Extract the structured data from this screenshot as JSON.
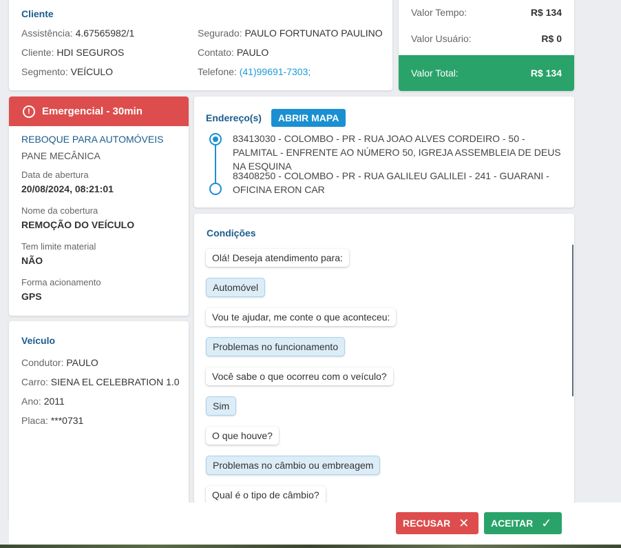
{
  "client": {
    "title": "Cliente",
    "assistencia_label": "Assistência:",
    "assistencia_value": "4.67565982/1",
    "cliente_label": "Cliente:",
    "cliente_value": "HDI SEGUROS",
    "segmento_label": "Segmento:",
    "segmento_value": "VEÍCULO",
    "segurado_label": "Segurado:",
    "segurado_value": "PAULO FORTUNATO PAULINO",
    "contato_label": "Contato:",
    "contato_value": "PAULO",
    "telefone_label": "Telefone:",
    "telefone_value": "(41)99691-7303;"
  },
  "values": {
    "tempo_label": "Valor Tempo:",
    "tempo_value": "R$ 134",
    "usuario_label": "Valor Usuário:",
    "usuario_value": "R$ 0",
    "total_label": "Valor Total:",
    "total_value": "R$ 134",
    "total_color": "#29a36a"
  },
  "emergency": {
    "banner_icon": "info-circle-icon",
    "banner_text": "Emergencial - 30min",
    "banner_color": "#de4d4d",
    "service_title": "REBOQUE PARA AUTOMÓVEIS",
    "service_sub": "PANE MECÂNICA",
    "fields": [
      {
        "label": "Data de abertura",
        "value": "20/08/2024, 08:21:01"
      },
      {
        "label": "Nome da cobertura",
        "value": "REMOÇÃO DO VEÍCULO"
      },
      {
        "label": "Tem limite material",
        "value": "NÃO"
      },
      {
        "label": "Forma acionamento",
        "value": "GPS"
      }
    ]
  },
  "vehicle": {
    "title": "Veículo",
    "condutor_label": "Condutor:",
    "condutor_value": "PAULO",
    "carro_label": "Carro:",
    "carro_value": "SIENA EL CELEBRATION 1.0",
    "ano_label": "Ano:",
    "ano_value": "2011",
    "placa_label": "Placa:",
    "placa_value": "***0731"
  },
  "address": {
    "title": "Endereço(s)",
    "map_button": "ABRIR MAPA",
    "origin": "83413030 - COLOMBO - PR - RUA JOAO ALVES CORDEIRO - 50 - PALMITAL - ENFRENTE AO NÚMERO 50, IGREJA ASSEMBLEIA DE DEUS NA ESQUINA",
    "destination": "83408250 - COLOMBO - PR - RUA GALILEU GALILEI - 241 - GUARANI - OFICINA ERON CAR"
  },
  "conditions": {
    "title": "Condições",
    "messages": [
      {
        "from": "sys",
        "text": "Olá! Deseja atendimento para:"
      },
      {
        "from": "usr",
        "text": "Automóvel"
      },
      {
        "from": "sys",
        "text": "Vou te ajudar, me conte o que aconteceu:"
      },
      {
        "from": "usr",
        "text": "Problemas no funcionamento"
      },
      {
        "from": "sys",
        "text": "Você sabe o que ocorreu com o veículo?"
      },
      {
        "from": "usr",
        "text": "Sim"
      },
      {
        "from": "sys",
        "text": "O que houve?"
      },
      {
        "from": "usr",
        "text": "Problemas no câmbio ou embreagem"
      },
      {
        "from": "sys",
        "text": "Qual é o tipo de câmbio?"
      }
    ]
  },
  "footer": {
    "reject_label": "RECUSAR",
    "reject_icon": "close-icon",
    "reject_color": "#de4d4d",
    "accept_label": "ACEITAR",
    "accept_icon": "check-icon",
    "accept_color": "#29a36a"
  }
}
